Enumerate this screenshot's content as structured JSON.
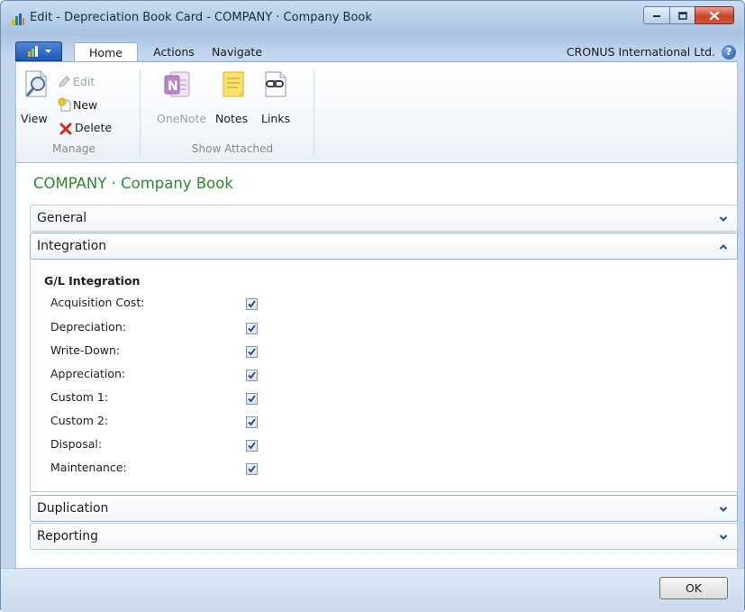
{
  "window": {
    "title": "Edit - Depreciation Book Card - COMPANY · Company Book"
  },
  "ribbon": {
    "tabs": [
      "Home",
      "Actions",
      "Navigate"
    ],
    "active_tab": "Home",
    "company_name": "CRONUS International Ltd.",
    "groups": {
      "manage": {
        "label": "Manage",
        "view_label": "View",
        "edit_label": "Edit",
        "new_label": "New",
        "delete_label": "Delete"
      },
      "show_attached": {
        "label": "Show Attached",
        "onenote_label": "OneNote",
        "notes_label": "Notes",
        "links_label": "Links"
      }
    }
  },
  "page": {
    "title": "COMPANY · Company Book"
  },
  "fasttabs": {
    "general": "General",
    "integration": "Integration",
    "duplication": "Duplication",
    "reporting": "Reporting"
  },
  "integration": {
    "group_heading": "G/L Integration",
    "fields": [
      {
        "label": "Acquisition Cost:",
        "checked": true
      },
      {
        "label": "Depreciation:",
        "checked": true
      },
      {
        "label": "Write-Down:",
        "checked": true
      },
      {
        "label": "Appreciation:",
        "checked": true
      },
      {
        "label": "Custom 1:",
        "checked": true
      },
      {
        "label": "Custom 2:",
        "checked": true
      },
      {
        "label": "Disposal:",
        "checked": true
      },
      {
        "label": "Maintenance:",
        "checked": true
      }
    ]
  },
  "footer": {
    "ok_label": "OK"
  },
  "colors": {
    "page_title": "#2d8a2d",
    "accent_blue": "#1b57b5",
    "close_red": "#c9432a"
  }
}
